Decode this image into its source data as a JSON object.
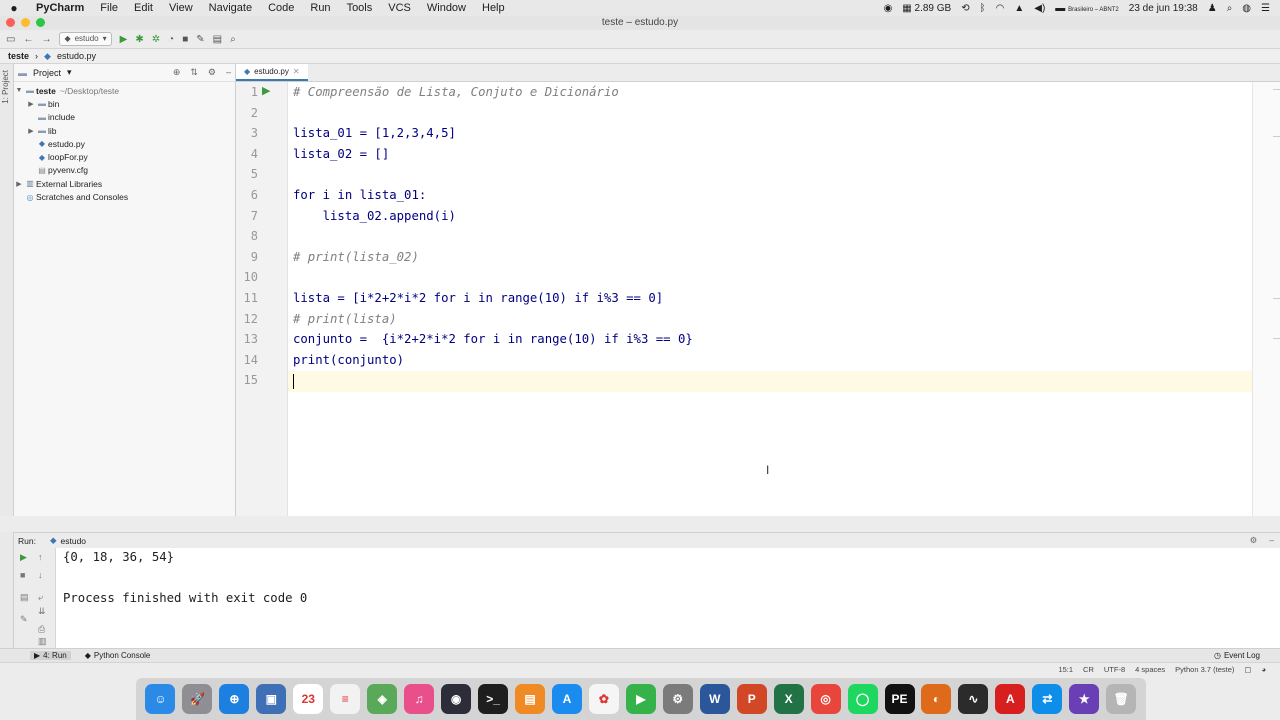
{
  "menubar": {
    "app": "PyCharm",
    "items": [
      "File",
      "Edit",
      "View",
      "Navigate",
      "Code",
      "Run",
      "Tools",
      "VCS",
      "Window",
      "Help"
    ],
    "memory": "2.89 GB",
    "keyboard": "Brasileiro – ABNT2",
    "datetime": "23 de jun  19:38"
  },
  "window": {
    "title": "teste – estudo.py"
  },
  "toolbar": {
    "run_config": "estudo"
  },
  "breadcrumbs": [
    "teste",
    "estudo.py"
  ],
  "left_strip": {
    "label": "1: Project"
  },
  "project": {
    "title": "Project",
    "tree": [
      {
        "name": "teste",
        "extra": "~/Desktop/teste",
        "level": 0,
        "type": "folder",
        "expanded": true
      },
      {
        "name": "bin",
        "level": 1,
        "type": "folder",
        "expanded": false
      },
      {
        "name": "include",
        "level": 1,
        "type": "folder",
        "expanded": null
      },
      {
        "name": "lib",
        "level": 1,
        "type": "folder",
        "expanded": false
      },
      {
        "name": "estudo.py",
        "level": 1,
        "type": "python"
      },
      {
        "name": "loopFor.py",
        "level": 1,
        "type": "python"
      },
      {
        "name": "pyvenv.cfg",
        "level": 1,
        "type": "config"
      },
      {
        "name": "External Libraries",
        "level": 0,
        "type": "library",
        "expanded": false
      },
      {
        "name": "Scratches and Consoles",
        "level": 0,
        "type": "scratch",
        "expanded": null
      }
    ]
  },
  "editor": {
    "tab": "estudo.py",
    "lines": [
      {
        "n": "1",
        "text": "# Compreensão de Lista, Conjuto e Dicionário",
        "comment": true
      },
      {
        "n": "2",
        "text": "",
        "comment": false
      },
      {
        "n": "3",
        "text": "lista_01 = [1,2,3,4,5]",
        "comment": false
      },
      {
        "n": "4",
        "text": "lista_02 = []",
        "comment": false
      },
      {
        "n": "5",
        "text": "",
        "comment": false
      },
      {
        "n": "6",
        "text": "for i in lista_01:",
        "comment": false
      },
      {
        "n": "7",
        "text": "    lista_02.append(i)",
        "comment": false
      },
      {
        "n": "8",
        "text": "",
        "comment": false
      },
      {
        "n": "9",
        "text": "# print(lista_02)",
        "comment": true
      },
      {
        "n": "10",
        "text": "",
        "comment": false
      },
      {
        "n": "11",
        "text": "lista = [i*2+2*i*2 for i in range(10) if i%3 == 0]",
        "comment": false
      },
      {
        "n": "12",
        "text": "# print(lista)",
        "comment": true
      },
      {
        "n": "13",
        "text": "conjunto =  {i*2+2*i*2 for i in range(10) if i%3 == 0}",
        "comment": false
      },
      {
        "n": "14",
        "text": "print(conjunto)",
        "comment": false
      },
      {
        "n": "15",
        "text": "",
        "comment": false
      }
    ]
  },
  "run": {
    "label": "Run:",
    "tab": "estudo",
    "output": [
      "{0, 18, 36, 54}",
      "",
      "Process finished with exit code 0"
    ]
  },
  "bottom_tabs": {
    "run": "4: Run",
    "console": "Python Console",
    "event_log": "Event Log"
  },
  "status": {
    "position": "15:1",
    "line_sep": "CR",
    "encoding": "UTF-8",
    "indent": "4 spaces",
    "interpreter": "Python 3.7 (teste)"
  },
  "dock": [
    {
      "name": "finder",
      "color": "#2b8ae6",
      "glyph": "☺"
    },
    {
      "name": "launchpad",
      "color": "#8e8e93",
      "glyph": "🚀"
    },
    {
      "name": "safari",
      "color": "#1d7fe0",
      "glyph": "⊕"
    },
    {
      "name": "preview",
      "color": "#3f6fb5",
      "glyph": "▣"
    },
    {
      "name": "calendar",
      "color": "#ffffff",
      "glyph": "23"
    },
    {
      "name": "notes",
      "color": "#f2f2f2",
      "glyph": "≡"
    },
    {
      "name": "maps",
      "color": "#5aa85a",
      "glyph": "◈"
    },
    {
      "name": "itunes",
      "color": "#e94f8a",
      "glyph": "♫"
    },
    {
      "name": "quicktime",
      "color": "#2d2d3a",
      "glyph": "◉"
    },
    {
      "name": "terminal",
      "color": "#1e1e1e",
      "glyph": ">_"
    },
    {
      "name": "books",
      "color": "#f08a24",
      "glyph": "▤"
    },
    {
      "name": "app-store",
      "color": "#1a8cf0",
      "glyph": "A"
    },
    {
      "name": "photos",
      "color": "#f5f5f5",
      "glyph": "✿"
    },
    {
      "name": "facetime",
      "color": "#35b34a",
      "glyph": "▶"
    },
    {
      "name": "system-preferences",
      "color": "#7b7b7b",
      "glyph": "⚙"
    },
    {
      "name": "word",
      "color": "#2b579a",
      "glyph": "W"
    },
    {
      "name": "powerpoint",
      "color": "#d24726",
      "glyph": "P"
    },
    {
      "name": "excel",
      "color": "#217346",
      "glyph": "X"
    },
    {
      "name": "chrome",
      "color": "#e8453c",
      "glyph": "◎"
    },
    {
      "name": "spotify",
      "color": "#1ed760",
      "glyph": "◯"
    },
    {
      "name": "pycharm",
      "color": "#111111",
      "glyph": "PE"
    },
    {
      "name": "firefox",
      "color": "#e06a1b",
      "glyph": "◐"
    },
    {
      "name": "activity-monitor",
      "color": "#2b2b2b",
      "glyph": "∿"
    },
    {
      "name": "acrobat",
      "color": "#d71f1f",
      "glyph": "A"
    },
    {
      "name": "teamviewer",
      "color": "#0e8ee9",
      "glyph": "⇄"
    },
    {
      "name": "imovie",
      "color": "#6a3fb5",
      "glyph": "★"
    },
    {
      "name": "trash",
      "color": "#b5b5b5",
      "glyph": "🗑"
    }
  ]
}
